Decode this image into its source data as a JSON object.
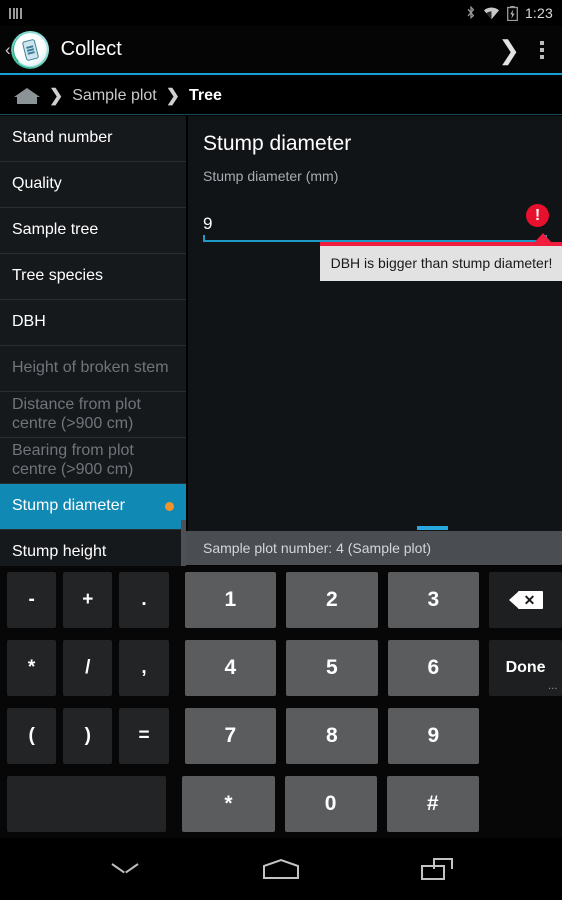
{
  "statusbar": {
    "signal_icon": "signal-bars-icon",
    "bluetooth_icon": "bluetooth-icon",
    "wifi_icon": "wifi-icon",
    "battery_icon": "battery-charging-icon",
    "time": "1:23"
  },
  "actionbar": {
    "back_glyph": "‹",
    "app_icon": "collect-app-icon",
    "title": "Collect",
    "next_glyph": "❯",
    "overflow_icon": "overflow-menu-icon"
  },
  "breadcrumb": {
    "home_icon": "home-icon",
    "separator": "❯",
    "items": [
      {
        "label": "Sample plot",
        "current": false
      },
      {
        "label": "Tree",
        "current": true
      }
    ]
  },
  "sidebar": {
    "items": [
      {
        "label": "Stand number",
        "state": "normal"
      },
      {
        "label": "Quality",
        "state": "normal"
      },
      {
        "label": "Sample tree",
        "state": "normal"
      },
      {
        "label": "Tree species",
        "state": "normal"
      },
      {
        "label": "DBH",
        "state": "normal"
      },
      {
        "label": "Height of broken stem",
        "state": "disabled"
      },
      {
        "label": "Distance from plot centre (>900 cm)",
        "state": "disabled"
      },
      {
        "label": "Bearing from plot centre (>900 cm)",
        "state": "disabled"
      },
      {
        "label": "Stump diameter",
        "state": "selected",
        "dot": true
      },
      {
        "label": "Stump height",
        "state": "normal"
      }
    ]
  },
  "main": {
    "title": "Stump diameter",
    "field_label": "Stump diameter (mm)",
    "field_value": "9",
    "field_placeholder": "",
    "error_icon": "error-exclamation-icon",
    "error_glyph": "!",
    "error_message": "DBH is bigger than stump diameter!"
  },
  "bottombar": {
    "text": "Sample plot number: 4 (Sample plot)"
  },
  "keyboard": {
    "rows": [
      {
        "symbols": [
          "-",
          "+",
          "."
        ],
        "numbers": [
          "1",
          "2",
          "3"
        ],
        "util": {
          "label": "",
          "icon": "backspace-icon",
          "popup": ""
        }
      },
      {
        "symbols": [
          "*",
          "/",
          ","
        ],
        "numbers": [
          "4",
          "5",
          "6"
        ],
        "util": {
          "label": "Done",
          "icon": "",
          "popup": "···"
        }
      },
      {
        "symbols": [
          "(",
          ")",
          "="
        ],
        "numbers": [
          "7",
          "8",
          "9"
        ],
        "util": {
          "label": "",
          "icon": "",
          "popup": ""
        }
      },
      {
        "symbols": [
          ""
        ],
        "numbers": [
          "*",
          "0",
          "#"
        ],
        "util": {
          "label": "",
          "icon": "",
          "popup": ""
        }
      }
    ]
  },
  "navbar": {
    "hide_keyboard_icon": "chevron-down-icon",
    "home_icon": "home-pentagon-icon",
    "recents_icon": "recents-icon"
  },
  "colors": {
    "accent": "#1189b5",
    "accent_line": "#159fd4",
    "underline": "#1f9ac6",
    "error": "#e8112d",
    "tooltip_border": "#f01e3c",
    "dot": "#f0932b",
    "tab_indicator": "#2aa9e0"
  }
}
